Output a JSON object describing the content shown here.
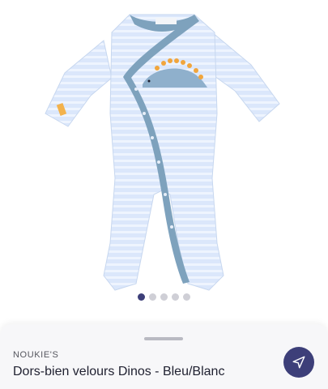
{
  "product": {
    "brand": "NOUKIE'S",
    "title": "Dors-bien velours Dinos - Bleu/Blanc"
  },
  "gallery": {
    "image_count": 5,
    "active_index": 0
  },
  "actions": {
    "share_icon": "send-arrow-icon"
  },
  "colors": {
    "accent": "#3d3f79",
    "garment": "#d8e6fa",
    "trim": "#7ea2bd",
    "dino_spikes": "#f1a53c"
  }
}
